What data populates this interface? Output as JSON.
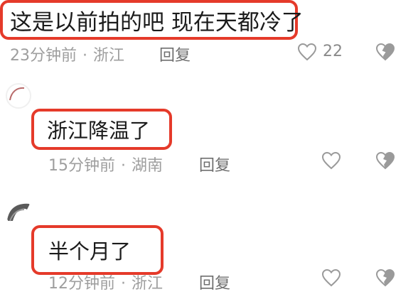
{
  "comments": [
    {
      "text": "这是以前拍的吧 现在天都冷了",
      "time": "23分钟前",
      "location": "浙江",
      "reply_label": "回复",
      "like_count": "22"
    },
    {
      "text": "浙江降温了",
      "time": "15分钟前",
      "location": "湖南",
      "reply_label": "回复"
    },
    {
      "text": "半个月了",
      "time": "12分钟前",
      "location": "浙江",
      "reply_label": "回复"
    }
  ],
  "separator": "·",
  "colors": {
    "highlight_border": "#e53a2a",
    "meta_text": "#9e9e9e",
    "icon_stroke": "#9a9a9a"
  },
  "icons": [
    "heart-icon",
    "broken-heart-icon",
    "avatar"
  ]
}
